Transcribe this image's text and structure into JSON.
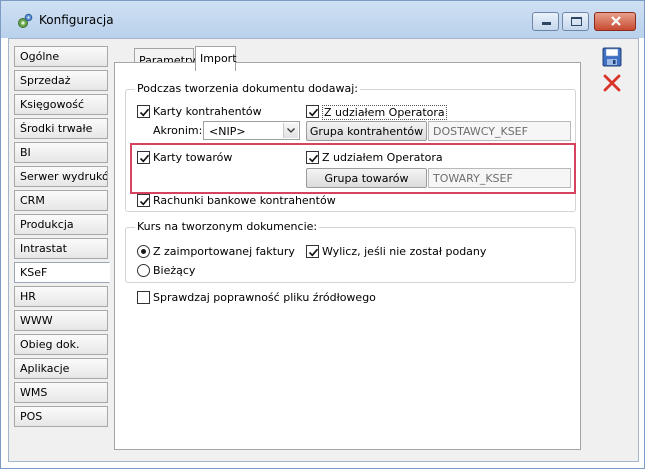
{
  "window": {
    "title": "Konfiguracja",
    "buttons": {
      "minimize": "minimize-icon",
      "maximize": "maximize-icon",
      "close": "close-icon"
    }
  },
  "sidebar": {
    "items": [
      {
        "label": "Ogólne"
      },
      {
        "label": "Sprzedaż"
      },
      {
        "label": "Księgowość"
      },
      {
        "label": "Środki trwałe"
      },
      {
        "label": "BI"
      },
      {
        "label": "Serwer wydruków"
      },
      {
        "label": "CRM"
      },
      {
        "label": "Produkcja"
      },
      {
        "label": "Intrastat"
      },
      {
        "label": "KSeF",
        "active": true
      },
      {
        "label": "HR"
      },
      {
        "label": "WWW"
      },
      {
        "label": "Obieg dok."
      },
      {
        "label": "Aplikacje"
      },
      {
        "label": "WMS"
      },
      {
        "label": "POS"
      }
    ]
  },
  "tabs": [
    {
      "label": "Parametry"
    },
    {
      "label": "Import",
      "active": true
    }
  ],
  "import": {
    "group1_title": "Podczas tworzenia dokumentu dodawaj:",
    "karty_kontrahentow": {
      "label": "Karty kontrahentów",
      "checked": true
    },
    "z_udzialem_op_1": {
      "label": "Z udziałem Operatora",
      "checked": true
    },
    "akronim_label": "Akronim:",
    "akronim_value": "<NIP>",
    "grupa_kontrahentow_button": "Grupa kontrahentów",
    "grupa_kontrahentow_value": "DOSTAWCY_KSEF",
    "karty_towarow": {
      "label": "Karty towarów",
      "checked": true
    },
    "z_udzialem_op_2": {
      "label": "Z udziałem Operatora",
      "checked": true
    },
    "grupa_towarow_button": "Grupa towarów",
    "grupa_towarow_value": "TOWARY_KSEF",
    "rachunki": {
      "label": "Rachunki bankowe kontrahentów",
      "checked": true
    },
    "group2_title": "Kurs na tworzonym dokumencie:",
    "radio_z_faktury": {
      "label": "Z zaimportowanej faktury",
      "selected": true
    },
    "radio_biezacy": {
      "label": "Bieżący",
      "selected": false
    },
    "wylicz": {
      "label": "Wylicz, jeśli nie został podany",
      "checked": true
    },
    "sprawdzaj": {
      "label": "Sprawdzaj poprawność pliku źródłowego",
      "checked": false
    }
  },
  "toolbar": {
    "save": "save-icon",
    "cancel": "cancel-icon"
  },
  "colors": {
    "highlight": "#d5435e",
    "title_bar": "#c4d8ef",
    "close_button": "#c84a31"
  }
}
